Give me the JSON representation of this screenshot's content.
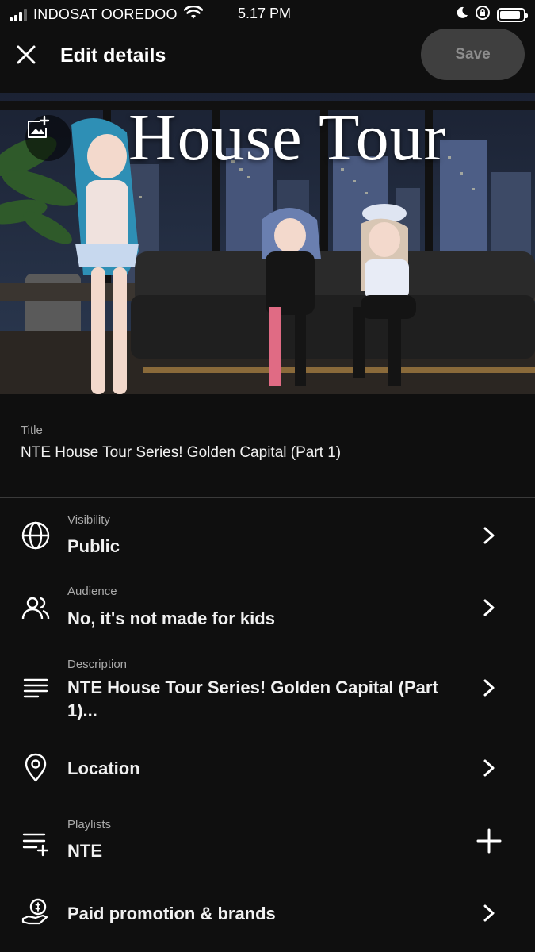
{
  "status_bar": {
    "carrier": "INDOSAT OOREDOO",
    "time": "5.17 PM",
    "battery_level": 0.9
  },
  "header": {
    "title": "Edit details",
    "save_label": "Save",
    "close_icon": "close-icon"
  },
  "thumbnail": {
    "overlay_text": "House Tour",
    "add_icon": "add-image-icon"
  },
  "title_field": {
    "label": "Title",
    "value": "NTE House Tour Series! Golden Capital (Part 1)"
  },
  "rows": [
    {
      "icon": "globe-icon",
      "label": "Visibility",
      "value": "Public",
      "action": "chevron-right-icon"
    },
    {
      "icon": "people-icon",
      "label": "Audience",
      "value": "No, it's not made for kids",
      "action": "chevron-right-icon"
    },
    {
      "icon": "text-lines-icon",
      "label": "Description",
      "value": "NTE House Tour Series! Golden Capital (Part 1)...",
      "action": "chevron-right-icon"
    },
    {
      "icon": "location-pin-icon",
      "label": "",
      "value": "Location",
      "action": "chevron-right-icon"
    },
    {
      "icon": "playlist-add-icon",
      "label": "Playlists",
      "value": "NTE",
      "action": "plus-icon"
    },
    {
      "icon": "paid-promotion-icon",
      "label": "",
      "value": "Paid promotion & brands",
      "action": "chevron-right-icon"
    }
  ],
  "colors": {
    "background": "#0f0f0f",
    "text": "#f1f1f1",
    "secondary_text": "#aaaaaa",
    "save_button_bg": "#3f3f3f",
    "save_button_text": "#8d8d8d",
    "divider": "#3a3a3a"
  }
}
